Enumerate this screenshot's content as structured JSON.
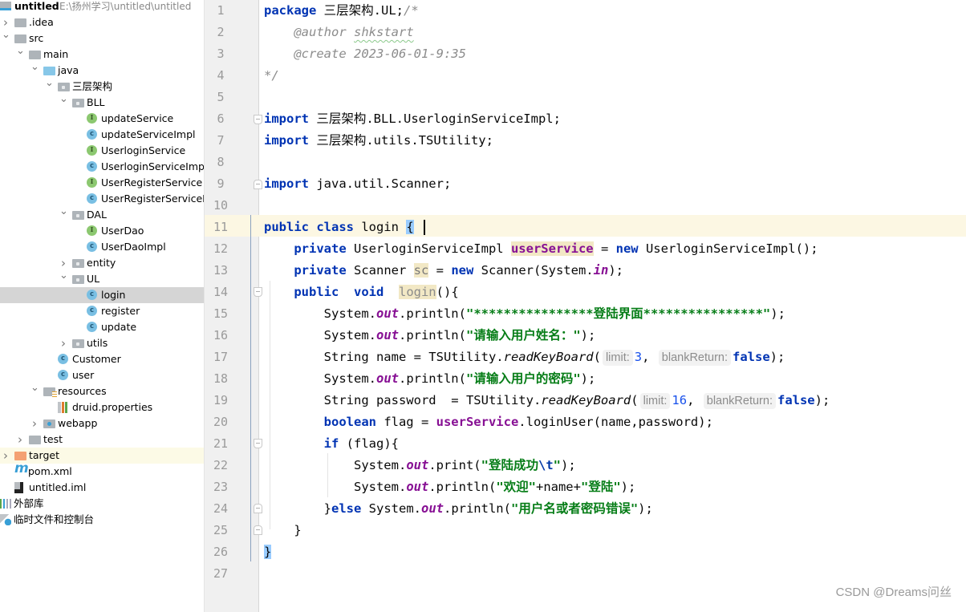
{
  "project_tree": {
    "root": {
      "name": "untitled",
      "path": "E:\\扬州学习\\untitled\\untitled"
    },
    "items": [
      {
        "label": ".idea",
        "type": "folder",
        "depth": 1,
        "expanded": false
      },
      {
        "label": "src",
        "type": "folder",
        "depth": 1,
        "expanded": true
      },
      {
        "label": "main",
        "type": "folder",
        "depth": 2,
        "expanded": true
      },
      {
        "label": "java",
        "type": "source-folder",
        "depth": 3,
        "expanded": true
      },
      {
        "label": "三层架构",
        "type": "package",
        "depth": 4,
        "expanded": true
      },
      {
        "label": "BLL",
        "type": "package",
        "depth": 5,
        "expanded": true
      },
      {
        "label": "updateService",
        "type": "interface",
        "depth": 6
      },
      {
        "label": "updateServiceImpl",
        "type": "class",
        "depth": 6
      },
      {
        "label": "UserloginService",
        "type": "interface",
        "depth": 6
      },
      {
        "label": "UserloginServiceImpl",
        "type": "class",
        "depth": 6
      },
      {
        "label": "UserRegisterService",
        "type": "interface",
        "depth": 6
      },
      {
        "label": "UserRegisterServiceImpl",
        "type": "class",
        "depth": 6
      },
      {
        "label": "DAL",
        "type": "package",
        "depth": 5,
        "expanded": true
      },
      {
        "label": "UserDao",
        "type": "interface",
        "depth": 6
      },
      {
        "label": "UserDaoImpl",
        "type": "class",
        "depth": 6
      },
      {
        "label": "entity",
        "type": "package",
        "depth": 5,
        "expanded": false
      },
      {
        "label": "UL",
        "type": "package",
        "depth": 5,
        "expanded": true
      },
      {
        "label": "login",
        "type": "class",
        "depth": 6,
        "selected": true
      },
      {
        "label": "register",
        "type": "class",
        "depth": 6
      },
      {
        "label": "update",
        "type": "class",
        "depth": 6
      },
      {
        "label": "utils",
        "type": "package",
        "depth": 5,
        "expanded": false
      },
      {
        "label": "Customer",
        "type": "class",
        "depth": 4
      },
      {
        "label": "user",
        "type": "class",
        "depth": 4
      },
      {
        "label": "resources",
        "type": "resources-folder",
        "depth": 3,
        "expanded": true
      },
      {
        "label": "druid.properties",
        "type": "properties",
        "depth": 4
      },
      {
        "label": "webapp",
        "type": "web-folder",
        "depth": 3,
        "expanded": false
      },
      {
        "label": "test",
        "type": "folder",
        "depth": 2,
        "expanded": false
      },
      {
        "label": "target",
        "type": "excluded-folder",
        "depth": 1,
        "expanded": false
      },
      {
        "label": "pom.xml",
        "type": "maven",
        "depth": 1
      },
      {
        "label": "untitled.iml",
        "type": "iml",
        "depth": 1
      },
      {
        "label": "外部库",
        "type": "libraries",
        "depth": 0
      },
      {
        "label": "临时文件和控制台",
        "type": "scratches",
        "depth": 0
      }
    ]
  },
  "editor": {
    "current_line": 11,
    "line_numbers": [
      "1",
      "2",
      "3",
      "4",
      "5",
      "6",
      "7",
      "8",
      "9",
      "10",
      "11",
      "12",
      "13",
      "14",
      "15",
      "16",
      "17",
      "18",
      "19",
      "20",
      "21",
      "22",
      "23",
      "24",
      "25",
      "26",
      "27"
    ],
    "code": {
      "l1_kw": "package",
      "l1_rest": " 三层架构.UL;",
      "l1_cm": "/*",
      "l2_tag": "@author",
      "l2_val": "shkstart",
      "l3_tag": "@create",
      "l3_val": " 2023-06-01-9:35",
      "l4_cm": "*/",
      "l6_kw": "import",
      "l6_rest": " 三层架构.BLL.UserloginServiceImpl;",
      "l7_kw": "import",
      "l7_rest": " 三层架构.utils.TSUtility;",
      "l9_kw": "import",
      "l9_rest": " java.util.Scanner;",
      "l11_kw": "public class",
      "l11_rest": " login ",
      "l11_brace": "{",
      "l12_kw": "private",
      "l12_type": " UserloginServiceImpl ",
      "l12_field": "userService",
      "l12_eq": " = ",
      "l12_new": "new",
      "l12_rest": " UserloginServiceImpl();",
      "l13_kw": "private",
      "l13_type": " Scanner ",
      "l13_field": "sc",
      "l13_eq": " = ",
      "l13_new": "new",
      "l13_rest": " Scanner(System.",
      "l13_in": "in",
      "l13_end": ");",
      "l14_kw": "public  void",
      "l14_sp": "  ",
      "l14_name": "login",
      "l14_rest": "(){",
      "l15_a": "System.",
      "l15_out": "out",
      "l15_b": ".println(",
      "l15_str": "\"****************登陆界面****************\"",
      "l15_end": ");",
      "l16_a": "System.",
      "l16_out": "out",
      "l16_b": ".println(",
      "l16_str": "\"请输入用户姓名：\"",
      "l16_end": ");",
      "l17_a": "String name = TSUtility.",
      "l17_m": "readKeyBoard",
      "l17_p": "(",
      "l17_hint1": "limit:",
      "l17_n": "3",
      "l17_c": ", ",
      "l17_hint2": "blankReturn:",
      "l17_f": "false",
      "l17_end": ");",
      "l18_a": "System.",
      "l18_out": "out",
      "l18_b": ".println(",
      "l18_str": "\"请输入用户的密码\"",
      "l18_end": ");",
      "l19_a": "String password  = TSUtility.",
      "l19_m": "readKeyBoard",
      "l19_p": "(",
      "l19_hint1": "limit:",
      "l19_n": "16",
      "l19_c": ", ",
      "l19_hint2": "blankReturn:",
      "l19_f": "false",
      "l19_end": ");",
      "l20_kw": "boolean",
      "l20_a": " flag = ",
      "l20_field": "userService",
      "l20_rest": ".loginUser(name,password);",
      "l21_kw": "if",
      "l21_rest": " (flag){",
      "l22_a": "System.",
      "l22_out": "out",
      "l22_b": ".print(",
      "l22_str": "\"登陆成功",
      "l22_esc": "\\t",
      "l22_str2": "\"",
      "l22_end": ");",
      "l23_a": "System.",
      "l23_out": "out",
      "l23_b": ".println(",
      "l23_s1": "\"欢迎\"",
      "l23_mid": "+name+",
      "l23_s2": "\"登陆\"",
      "l23_end": ");",
      "l24_a": "}",
      "l24_kw": "else",
      "l24_b": " System.",
      "l24_out": "out",
      "l24_c": ".println(",
      "l24_str": "\"用户名或者密码错误\"",
      "l24_end": ");",
      "l25": "}",
      "l26": "}"
    }
  },
  "watermark": "CSDN @Dreams问丝"
}
